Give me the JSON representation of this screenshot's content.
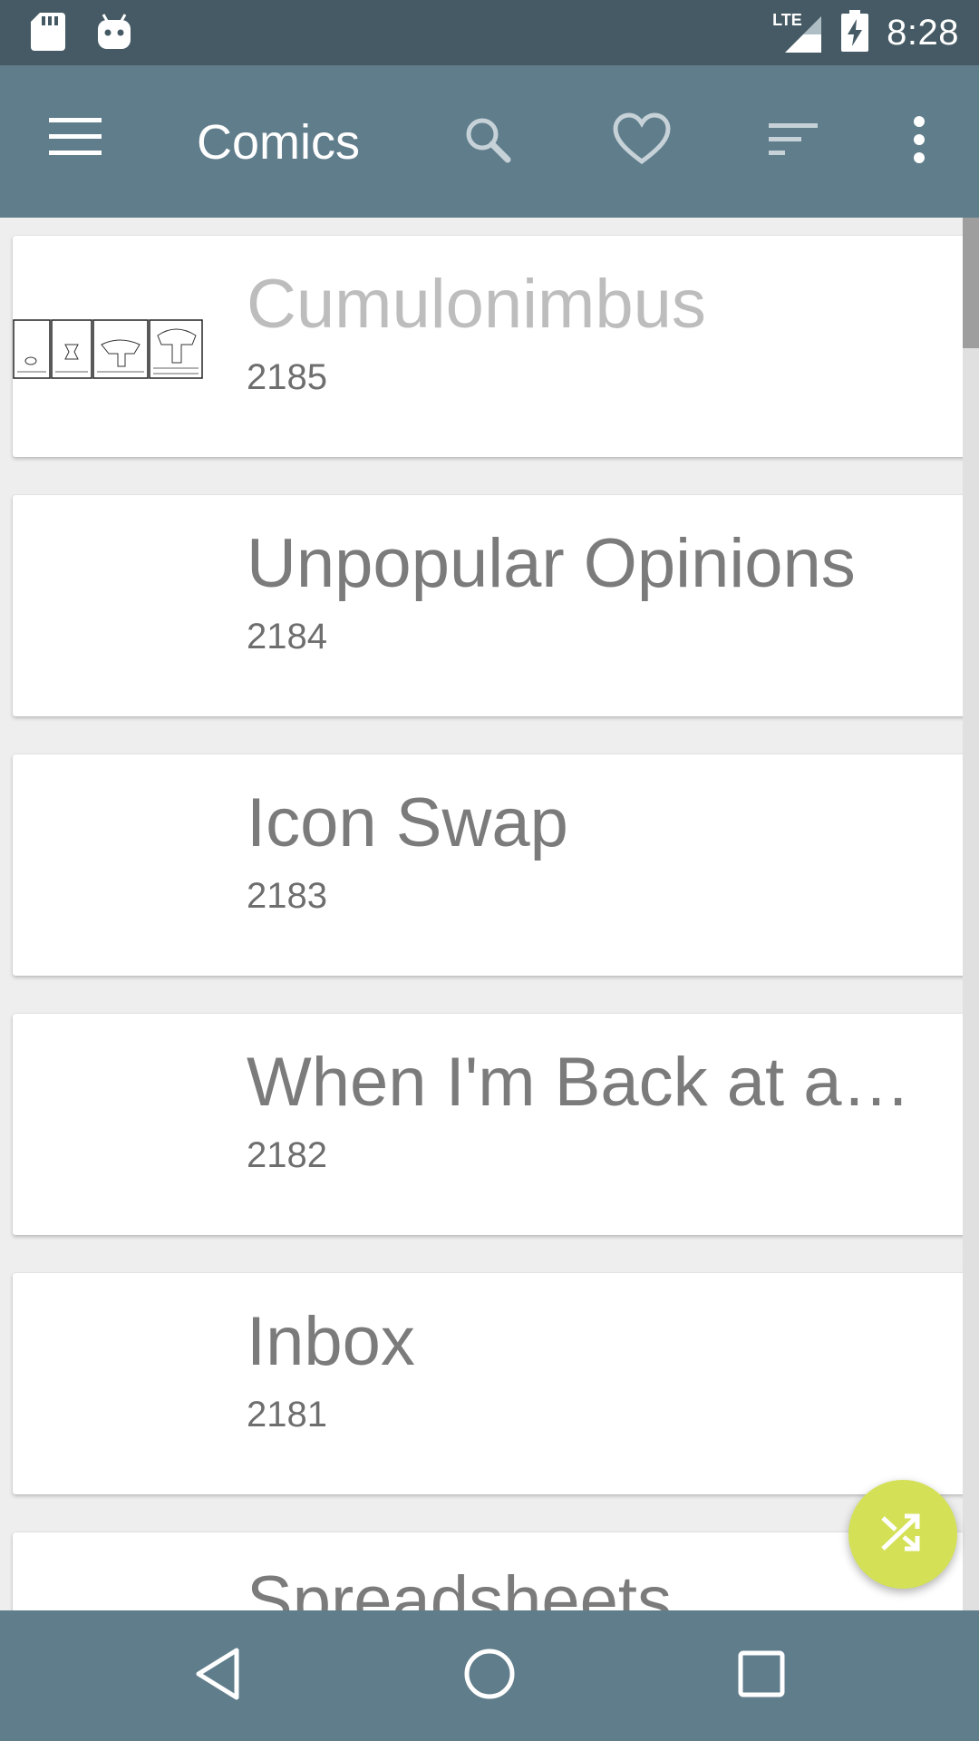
{
  "status_bar": {
    "time": "8:28",
    "network": "LTE",
    "icons": [
      "sd-card-icon",
      "android-icon",
      "signal-icon",
      "battery-charging-icon"
    ]
  },
  "app_bar": {
    "title": "Comics",
    "actions": [
      "menu-icon",
      "search-icon",
      "favorite-icon",
      "sort-icon",
      "more-icon"
    ]
  },
  "comics": [
    {
      "title": "Cumulonimbus",
      "number": "2185"
    },
    {
      "title": "Unpopular Opinions",
      "number": "2184"
    },
    {
      "title": "Icon Swap",
      "number": "2183"
    },
    {
      "title": "When I'm Back at a…",
      "number": "2182"
    },
    {
      "title": "Inbox",
      "number": "2181"
    },
    {
      "title": "Spreadsheets",
      "number": ""
    }
  ],
  "fab": {
    "icon": "shuffle-icon"
  },
  "nav_bar": {
    "icons": [
      "back-icon",
      "home-icon",
      "recents-icon"
    ]
  },
  "colors": {
    "status_bar": "#455a64",
    "app_bar": "#607d8b",
    "fab": "#d4e157",
    "card_title": "#7b7b7b"
  }
}
